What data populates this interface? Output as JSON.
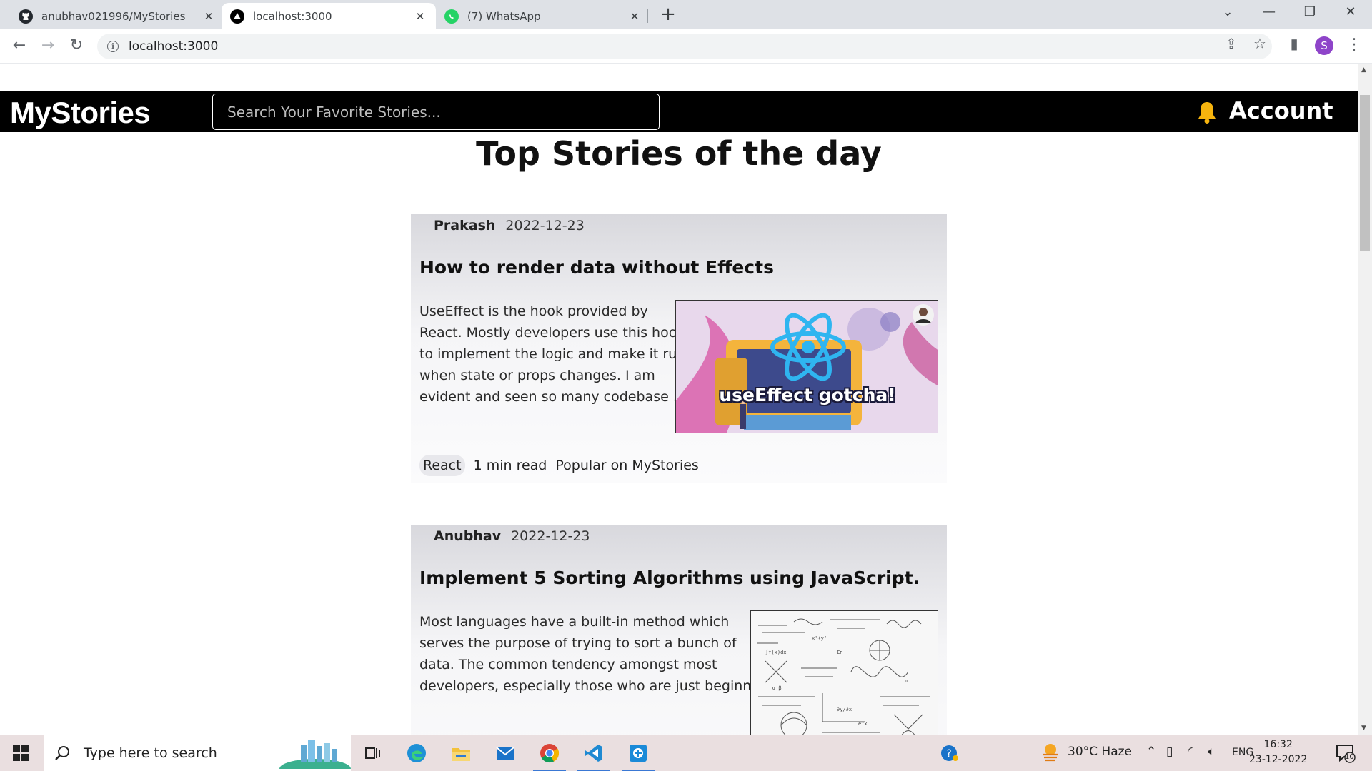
{
  "browser": {
    "tabs": [
      {
        "title": "anubhav021996/MyStories",
        "close": "✕"
      },
      {
        "title": "localhost:3000",
        "close": "✕"
      },
      {
        "title": "(7) WhatsApp",
        "close": "✕"
      }
    ],
    "new_tab": "+",
    "url": "localhost:3000",
    "profile_initial": "S"
  },
  "site": {
    "brand": "MyStories",
    "search_placeholder": "Search Your Favorite Stories...",
    "account_label": "Account",
    "page_title": "Top Stories of the day"
  },
  "stories": [
    {
      "author": "Prakash",
      "date": "2022-12-23",
      "title": "How to render data without Effects",
      "excerpt": [
        "UseEffect is the hook provided by",
        "React. Mostly developers use this hook",
        "to implement the logic and make it run",
        "when state or props changes. I am",
        "evident and seen so many codebase ..."
      ],
      "image_caption": "useEffect gotcha!",
      "tag": "React",
      "read_time": "1 min read",
      "badge": "Popular on MyStories"
    },
    {
      "author": "Anubhav",
      "date": "2022-12-23",
      "title": "Implement 5 Sorting Algorithms using JavaScript.",
      "excerpt": [
        "Most languages have a built-in method which",
        "serves the purpose of trying to sort a bunch of",
        "data. The common tendency amongst most",
        "developers, especially those who are just beginni..."
      ]
    }
  ],
  "taskbar": {
    "search_placeholder": "Type here to search",
    "weather": "30°C  Haze",
    "language": "ENG",
    "time": "16:32",
    "date": "23-12-2022",
    "notification_count": "10"
  }
}
